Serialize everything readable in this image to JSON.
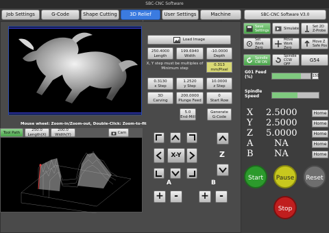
{
  "window": {
    "title": "SBC-CNC Software"
  },
  "tabs": [
    "Job Settings",
    "G-Code",
    "Shape Cutting",
    "3D Relief Carving",
    "User Settings",
    "Machine Settings"
  ],
  "active_tab": "3D Relief Carving",
  "version": "SBC-CNC Software V3.0",
  "relief": {
    "load_image": "Load Image",
    "length": {
      "value": "250.4000",
      "label": "Length"
    },
    "width": {
      "value": "199.6940",
      "label": "Width"
    },
    "depth": {
      "value": "-10.0000",
      "label": "Depth"
    },
    "note": "X, Y step must be multiples of Minimum step",
    "min_step": {
      "value": "0.313",
      "label": "mm/Pixel"
    },
    "x_step": {
      "value": "0.3130",
      "label": "x Step"
    },
    "y_step": {
      "value": "1.2520",
      "label": "y Step"
    },
    "z_step": {
      "value": "10.0000",
      "label": "z Step"
    },
    "carving": {
      "line1": "3D",
      "line2": "Carving"
    },
    "plunge": {
      "value": "200.0000",
      "label": "Plunge Feed"
    },
    "start_row": {
      "value": "0",
      "label": "Start Row"
    },
    "endmill": {
      "value": "5.0",
      "label": "End-Mill"
    },
    "generate": {
      "line1": "Generate",
      "line2": "G-Code"
    },
    "hint": "Mouse wheel: Zoom-in/Zoom-out, Double-Click: Zoom-to-fit"
  },
  "toolpath": {
    "tool_path": "Tool Path",
    "length": {
      "value": "250.0",
      "label": "Length(X)"
    },
    "width": {
      "value": "200.0",
      "label": "Width(Y)"
    },
    "cam": "Cam"
  },
  "jog": {
    "center": "X-Y",
    "z": "Z",
    "a": "A",
    "b": "B",
    "plus": "+",
    "minus": "-"
  },
  "right": {
    "buttons": [
      {
        "label": "Save Settings",
        "icon": "save-icon",
        "green": true
      },
      {
        "label": "Simulate",
        "icon": "simulate-icon",
        "green": false
      },
      {
        "label": "Set 2D Z-Probe",
        "icon": "probe-icon",
        "green": false
      },
      {
        "label": "Set Work Zero",
        "icon": "work-zero-icon",
        "green": false
      },
      {
        "label": "Move Work Zero",
        "icon": "move-icon",
        "green": false
      },
      {
        "label": "Move Z Safe Pos",
        "icon": "move-z-icon",
        "green": false
      },
      {
        "label": "Spindle CW ON",
        "icon": "spindle-cw-icon",
        "green": true
      },
      {
        "label": "Spindle CCW OFF",
        "icon": "spindle-ccw-icon",
        "green": false
      },
      {
        "label": "G54",
        "icon": "",
        "green": false
      }
    ],
    "g01_feed_label": "G01 Feed (%)",
    "g01_feed_value": "150",
    "g01_feed_fraction": 0.75,
    "spindle_speed_label": "Spindle Speed",
    "spindle_speed_fraction": 0.55,
    "axes": [
      {
        "axis": "X",
        "value": "2.5000"
      },
      {
        "axis": "Y",
        "value": "2.5000"
      },
      {
        "axis": "Z",
        "value": "5.0000"
      },
      {
        "axis": "A",
        "value": "NA"
      },
      {
        "axis": "B",
        "value": "NA"
      }
    ],
    "home": "Home",
    "start": "Start",
    "pause": "Pause",
    "reset": "Reset",
    "stop": "Stop"
  }
}
